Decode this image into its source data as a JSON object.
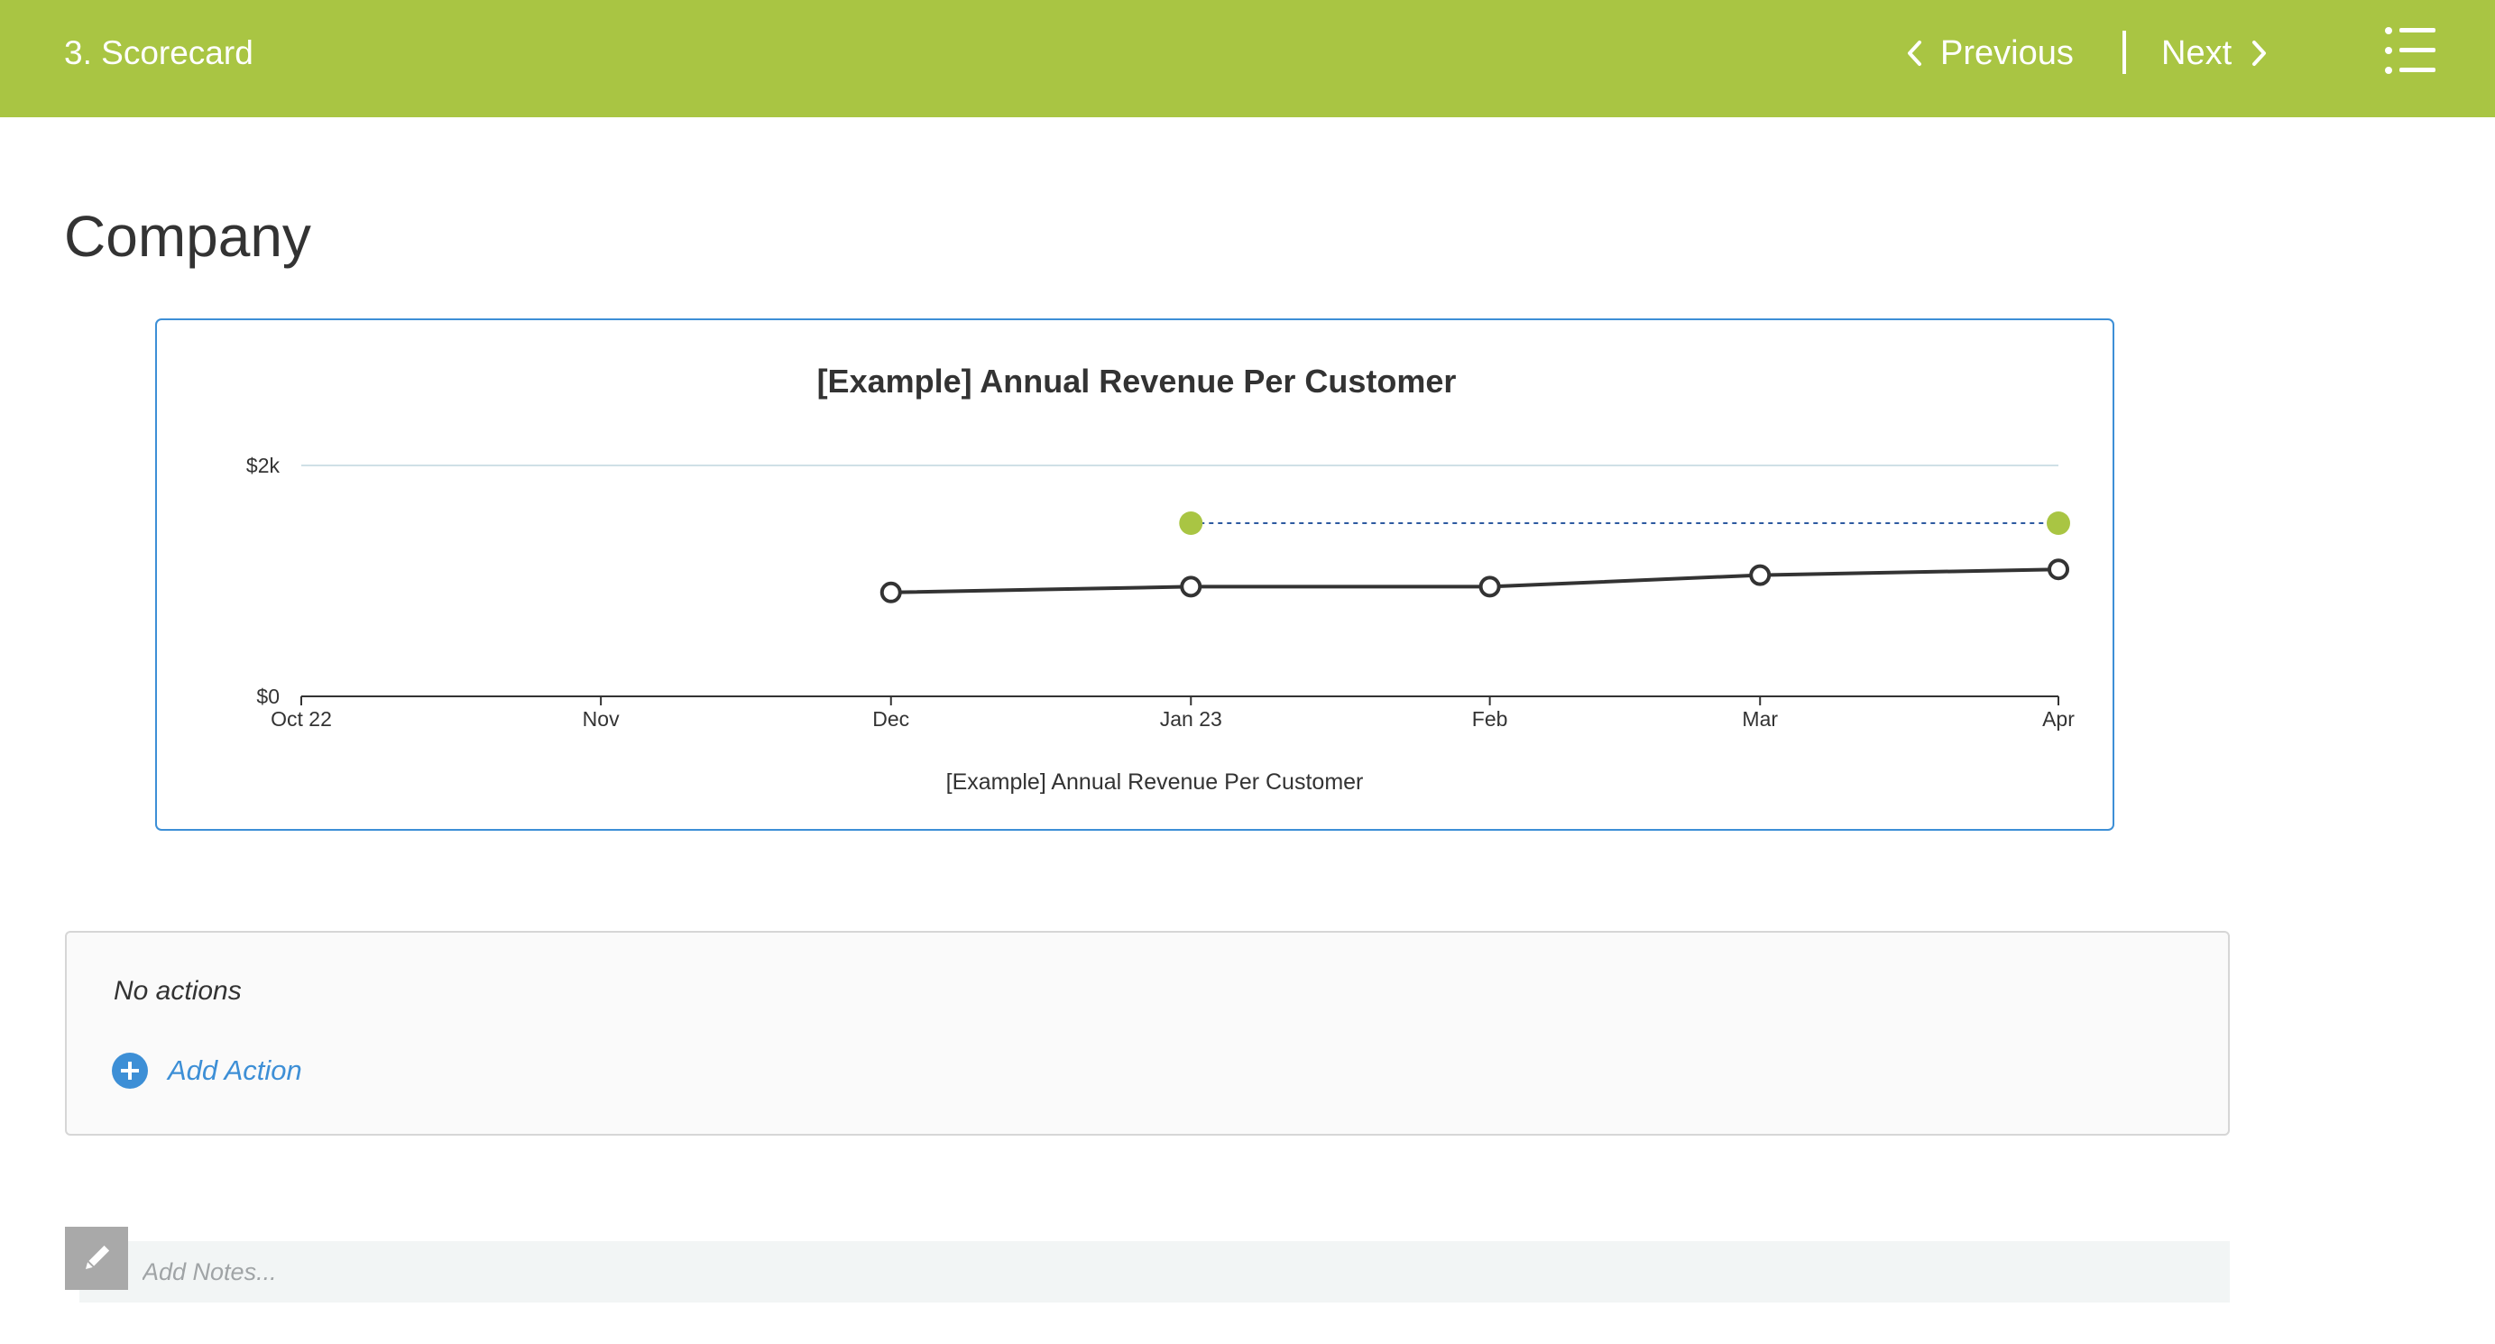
{
  "header": {
    "title": "3. Scorecard",
    "previous_label": "Previous",
    "next_label": "Next",
    "menu_icon": "list-menu-icon"
  },
  "page": {
    "title": "Company"
  },
  "colors": {
    "brand_green": "#a9c543",
    "accent_blue": "#3d8fd6",
    "actual_line": "#333333",
    "target_line": "#2d5aa0"
  },
  "chart_data": {
    "type": "line",
    "title": "[Example] Annual Revenue Per Customer",
    "xlabel": "[Example] Annual Revenue Per Customer",
    "ylabel": "",
    "categories": [
      "Oct 22",
      "Nov",
      "Dec",
      "Jan 23",
      "Feb",
      "Mar",
      "Apr"
    ],
    "y_tick_labels": [
      "$0",
      "$2k"
    ],
    "ylim": [
      0,
      2000
    ],
    "grid": true,
    "series": [
      {
        "style": "solid, dark line with hollow circle markers",
        "color": "#333333",
        "points": [
          {
            "x": "Dec",
            "y": 900
          },
          {
            "x": "Jan 23",
            "y": 950
          },
          {
            "x": "Feb",
            "y": 950
          },
          {
            "x": "Mar",
            "y": 1050
          },
          {
            "x": "Apr",
            "y": 1100
          }
        ]
      },
      {
        "style": "dashed blue line with green filled endpoints",
        "color": "#a9c543",
        "points": [
          {
            "x": "Jan 23",
            "y": 1500
          },
          {
            "x": "Apr",
            "y": 1500
          }
        ]
      }
    ]
  },
  "actions": {
    "empty_text": "No actions",
    "add_label": "Add Action"
  },
  "notes": {
    "placeholder": "Add Notes..."
  }
}
